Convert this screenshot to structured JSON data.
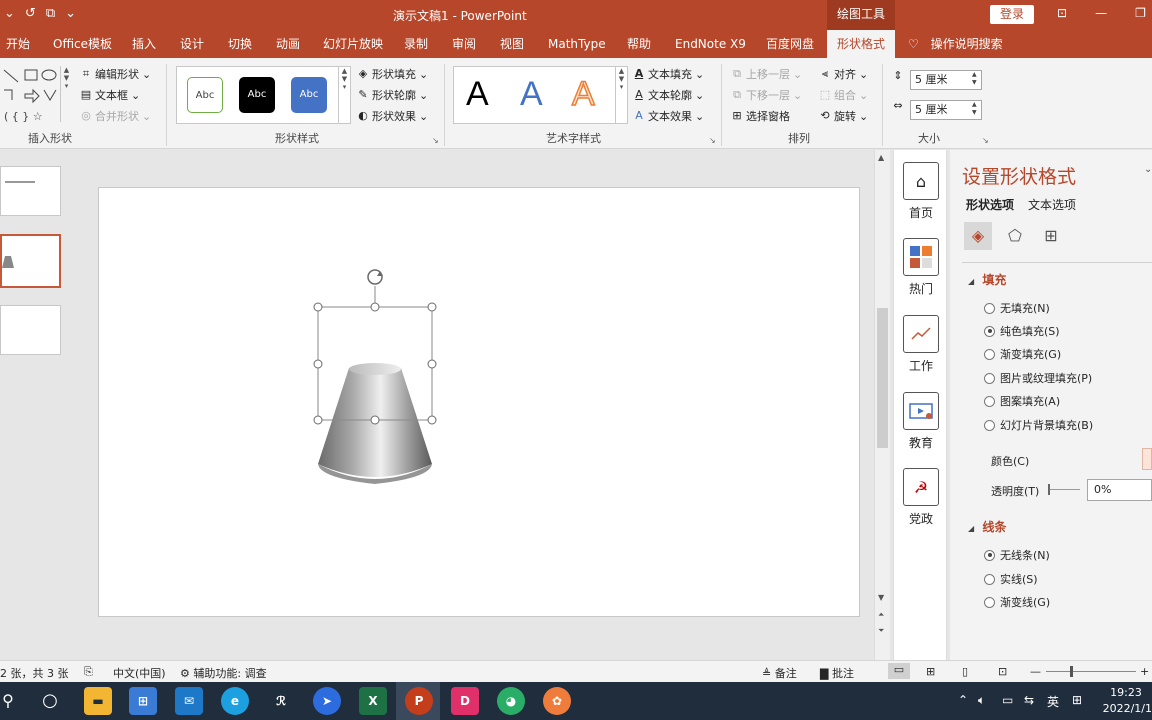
{
  "titlebar": {
    "title": "演示文稿1  -  PowerPoint",
    "contextual_tab": "绘图工具",
    "login": "登录"
  },
  "tabs": [
    "开始",
    "Office模板",
    "插入",
    "设计",
    "切换",
    "动画",
    "幻灯片放映",
    "录制",
    "审阅",
    "视图",
    "MathType",
    "帮助",
    "EndNote X9",
    "百度网盘",
    "形状格式",
    "操作说明搜索"
  ],
  "ribbon": {
    "insert_shape": {
      "label": "插入形状",
      "edit_shape": "编辑形状",
      "textbox": "文本框",
      "merge_shape": "合并形状"
    },
    "shape_style": {
      "label": "形状样式",
      "swatch_text": "Abc",
      "fill": "形状填充",
      "outline": "形状轮廓",
      "effect": "形状效果"
    },
    "wordart": {
      "label": "艺术字样式",
      "letter": "A",
      "text_fill": "文本填充",
      "text_outline": "文本轮廓",
      "text_effect": "文本效果"
    },
    "arrange": {
      "label": "排列",
      "bring_forward": "上移一层",
      "send_backward": "下移一层",
      "selection_pane": "选择窗格",
      "align": "对齐",
      "group": "组合",
      "rotate": "旋转"
    },
    "size": {
      "label": "大小",
      "height": "5 厘米",
      "width": "5 厘米"
    }
  },
  "addin": {
    "items": [
      "首页",
      "热门",
      "工作",
      "教育",
      "党政"
    ]
  },
  "pane": {
    "title": "设置形状格式",
    "tabs": [
      "形状选项",
      "文本选项"
    ],
    "fill_section": "填充",
    "fill_options": [
      "无填充(N)",
      "纯色填充(S)",
      "渐变填充(G)",
      "图片或纹理填充(P)",
      "图案填充(A)",
      "幻灯片背景填充(B)"
    ],
    "fill_selected_index": 1,
    "color_label": "颜色(C)",
    "transparency_label": "透明度(T)",
    "transparency_value": "0%",
    "line_section": "线条",
    "line_options": [
      "无线条(N)",
      "实线(S)",
      "渐变线(G)"
    ],
    "line_selected_index": 0
  },
  "statusbar": {
    "slide_info": "2 张，共 3 张",
    "language": "中文(中国)",
    "accessibility": "辅助功能: 调查",
    "notes": "备注",
    "comments": "批注"
  },
  "taskbar": {
    "ime": "英",
    "time": "19:23",
    "date": "2022/1/1"
  },
  "colors": {
    "accent": "#b7472a",
    "taskbar": "#1f2d3d"
  }
}
